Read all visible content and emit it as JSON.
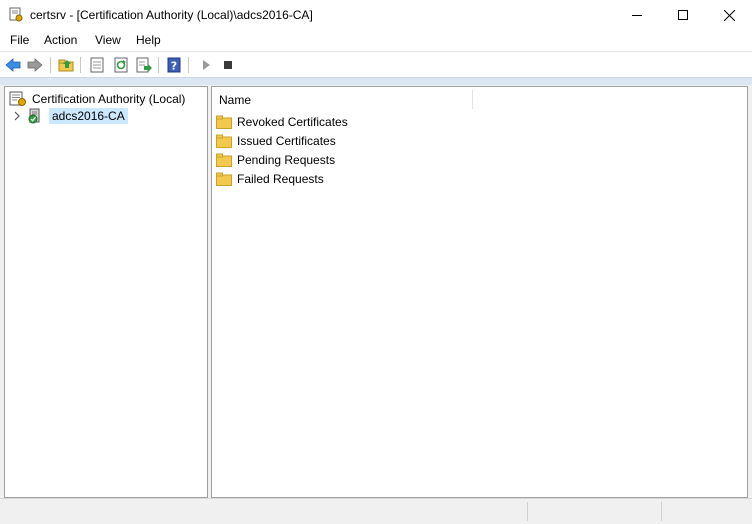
{
  "window": {
    "title": "certsrv - [Certification Authority (Local)\\adcs2016-CA]",
    "icon": "certsrv-app-icon"
  },
  "menu": {
    "items": [
      "File",
      "Action",
      "View",
      "Help"
    ]
  },
  "toolbar": {
    "buttons": [
      "back-arrow-icon",
      "forward-arrow-icon",
      "up-folder-icon",
      "properties-icon",
      "refresh-icon",
      "export-list-icon",
      "help-icon",
      "start-service-icon",
      "stop-service-icon"
    ]
  },
  "tree": {
    "root_label": "Certification Authority (Local)",
    "child_label": "adcs2016-CA"
  },
  "list": {
    "column_name": "Name",
    "items": [
      "Revoked Certificates",
      "Issued Certificates",
      "Pending Requests",
      "Failed Requests"
    ]
  },
  "colors": {
    "selection": "#cce8ff",
    "folder": "#f2c94c",
    "arrow_blue": "#3a8ee6",
    "pane_border": "#a0a0a0"
  }
}
